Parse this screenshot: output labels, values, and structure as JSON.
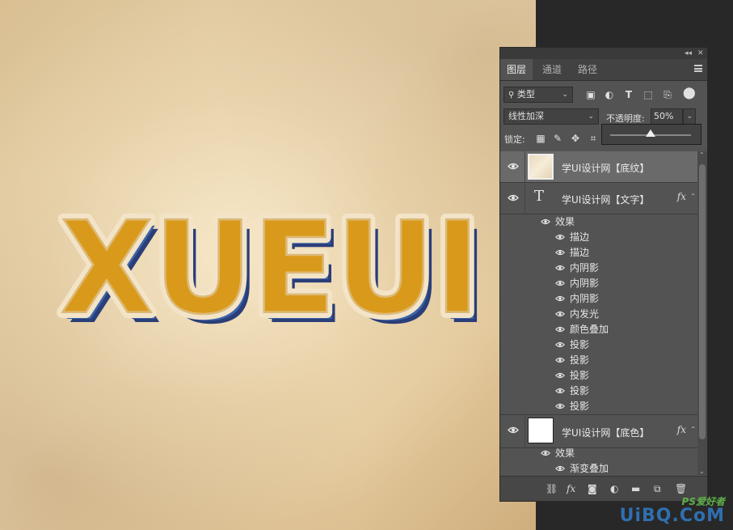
{
  "artwork": {
    "text": "XUEUI"
  },
  "panel": {
    "titlebar": {
      "collapse_icon": "double-chevron-left",
      "close_icon": "close-x"
    },
    "tabs": [
      {
        "label": "图层",
        "active": true
      },
      {
        "label": "通道",
        "active": false
      },
      {
        "label": "路径",
        "active": false
      }
    ],
    "filter": {
      "label": "类型",
      "icons": [
        "image-filter-icon",
        "adjustment-filter-icon",
        "type-filter-icon",
        "shape-filter-icon",
        "smart-object-filter-icon",
        "filter-toggle-icon"
      ]
    },
    "blend_mode": "线性加深",
    "opacity": {
      "label": "不透明度:",
      "value": "50%",
      "level": 0.5
    },
    "lock": {
      "label": "锁定:"
    },
    "layers": [
      {
        "name": "学UI设计网【底纹】",
        "selected": true,
        "has_fx": false,
        "thumb": "paper"
      },
      {
        "name": "学UI设计网【文字】",
        "selected": false,
        "has_fx": true,
        "thumb": "type",
        "effects_label": "效果",
        "effects": [
          "描边",
          "描边",
          "内阴影",
          "内阴影",
          "内阴影",
          "内发光",
          "颜色叠加",
          "投影",
          "投影",
          "投影",
          "投影",
          "投影"
        ]
      },
      {
        "name": "学UI设计网【底色】",
        "selected": false,
        "has_fx": true,
        "thumb": "white",
        "effects_label": "效果",
        "effects": [
          "渐变叠加"
        ]
      }
    ],
    "bottom_icons": [
      "link-layers-icon",
      "fx-icon",
      "mask-icon",
      "adjustment-icon",
      "folder-icon",
      "new-layer-icon",
      "trash-icon"
    ]
  },
  "watermark": {
    "line1": "PS爱好者",
    "line2": "UiBQ.CoM"
  },
  "colors": {
    "panel_bg": "#535353",
    "selected_layer": "#6a6a6a",
    "letter_fill": "#d99a1c",
    "letter_shadow": "#2f4d8c"
  }
}
